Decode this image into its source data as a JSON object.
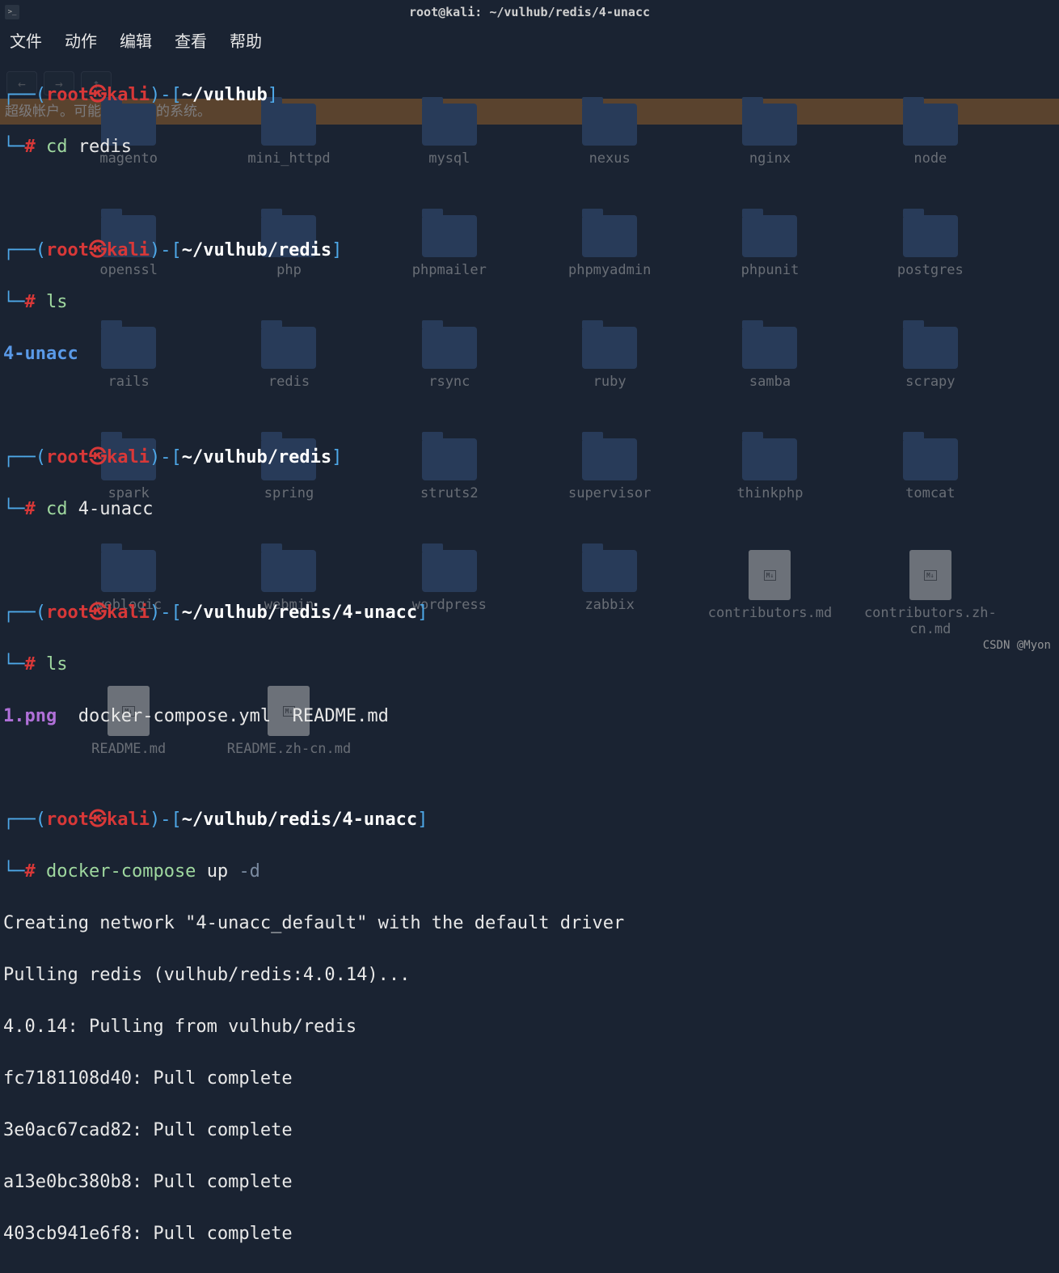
{
  "window": {
    "title": "root@kali: ~/vulhub/redis/4-unacc",
    "term_icon": ">_"
  },
  "menu": {
    "file": "文件",
    "action": "动作",
    "edit": "编辑",
    "view": "查看",
    "help": "帮助"
  },
  "bg": {
    "warning": "超级帐户。可能会损害您的系统。",
    "back": "←",
    "fwd": "→",
    "up": "↑",
    "items": {
      "r1c1": "magento",
      "r1c2": "mini_httpd",
      "r1c3": "mysql",
      "r1c4": "nexus",
      "r1c5": "nginx",
      "r1c6": "node",
      "r2c1": "openssl",
      "r2c2": "php",
      "r2c3": "phpmailer",
      "r2c4": "phpmyadmin",
      "r2c5": "phpunit",
      "r2c6": "postgres",
      "r3c1": "rails",
      "r3c2": "redis",
      "r3c3": "rsync",
      "r3c4": "ruby",
      "r3c5": "samba",
      "r3c6": "scrapy",
      "r4c1": "spark",
      "r4c2": "spring",
      "r4c3": "struts2",
      "r4c4": "supervisor",
      "r4c5": "thinkphp",
      "r4c6": "tomcat",
      "r5c1": "weblogic",
      "r5c2": "webmin",
      "r5c3": "wordpress",
      "r5c4": "zabbix",
      "r5c5": "contributors.md",
      "r5c6": "contributors.zh-cn.md",
      "r6c1": "README.md",
      "r6c2": "README.zh-cn.md"
    }
  },
  "prompt": {
    "user": "root",
    "sep": "㉿",
    "host": "kali",
    "path1": "~/vulhub",
    "path2": "~/vulhub/redis",
    "path3": "~/vulhub/redis/4-unacc"
  },
  "cmds": {
    "cd": "cd",
    "ls": "ls",
    "dc": "docker-compose",
    "up": "up",
    "flag_d": "-d",
    "arg_redis": "redis",
    "arg_4u": "4-unacc"
  },
  "listing": {
    "four_unacc": "4-unacc",
    "png": "1.png",
    "yml": "docker-compose.yml",
    "readme": "README.md"
  },
  "out": {
    "l1": "Creating network \"4-unacc_default\" with the default driver",
    "l2": "Pulling redis (vulhub/redis:4.0.14)...",
    "l3": "4.0.14: Pulling from vulhub/redis",
    "l4": "fc7181108d40: Pull complete",
    "l5": "3e0ac67cad82: Pull complete",
    "l6": "a13e0bc380b8: Pull complete",
    "l7": "403cb941e6f8: Pull complete"
  },
  "watermark": "CSDN @Myon⁣"
}
